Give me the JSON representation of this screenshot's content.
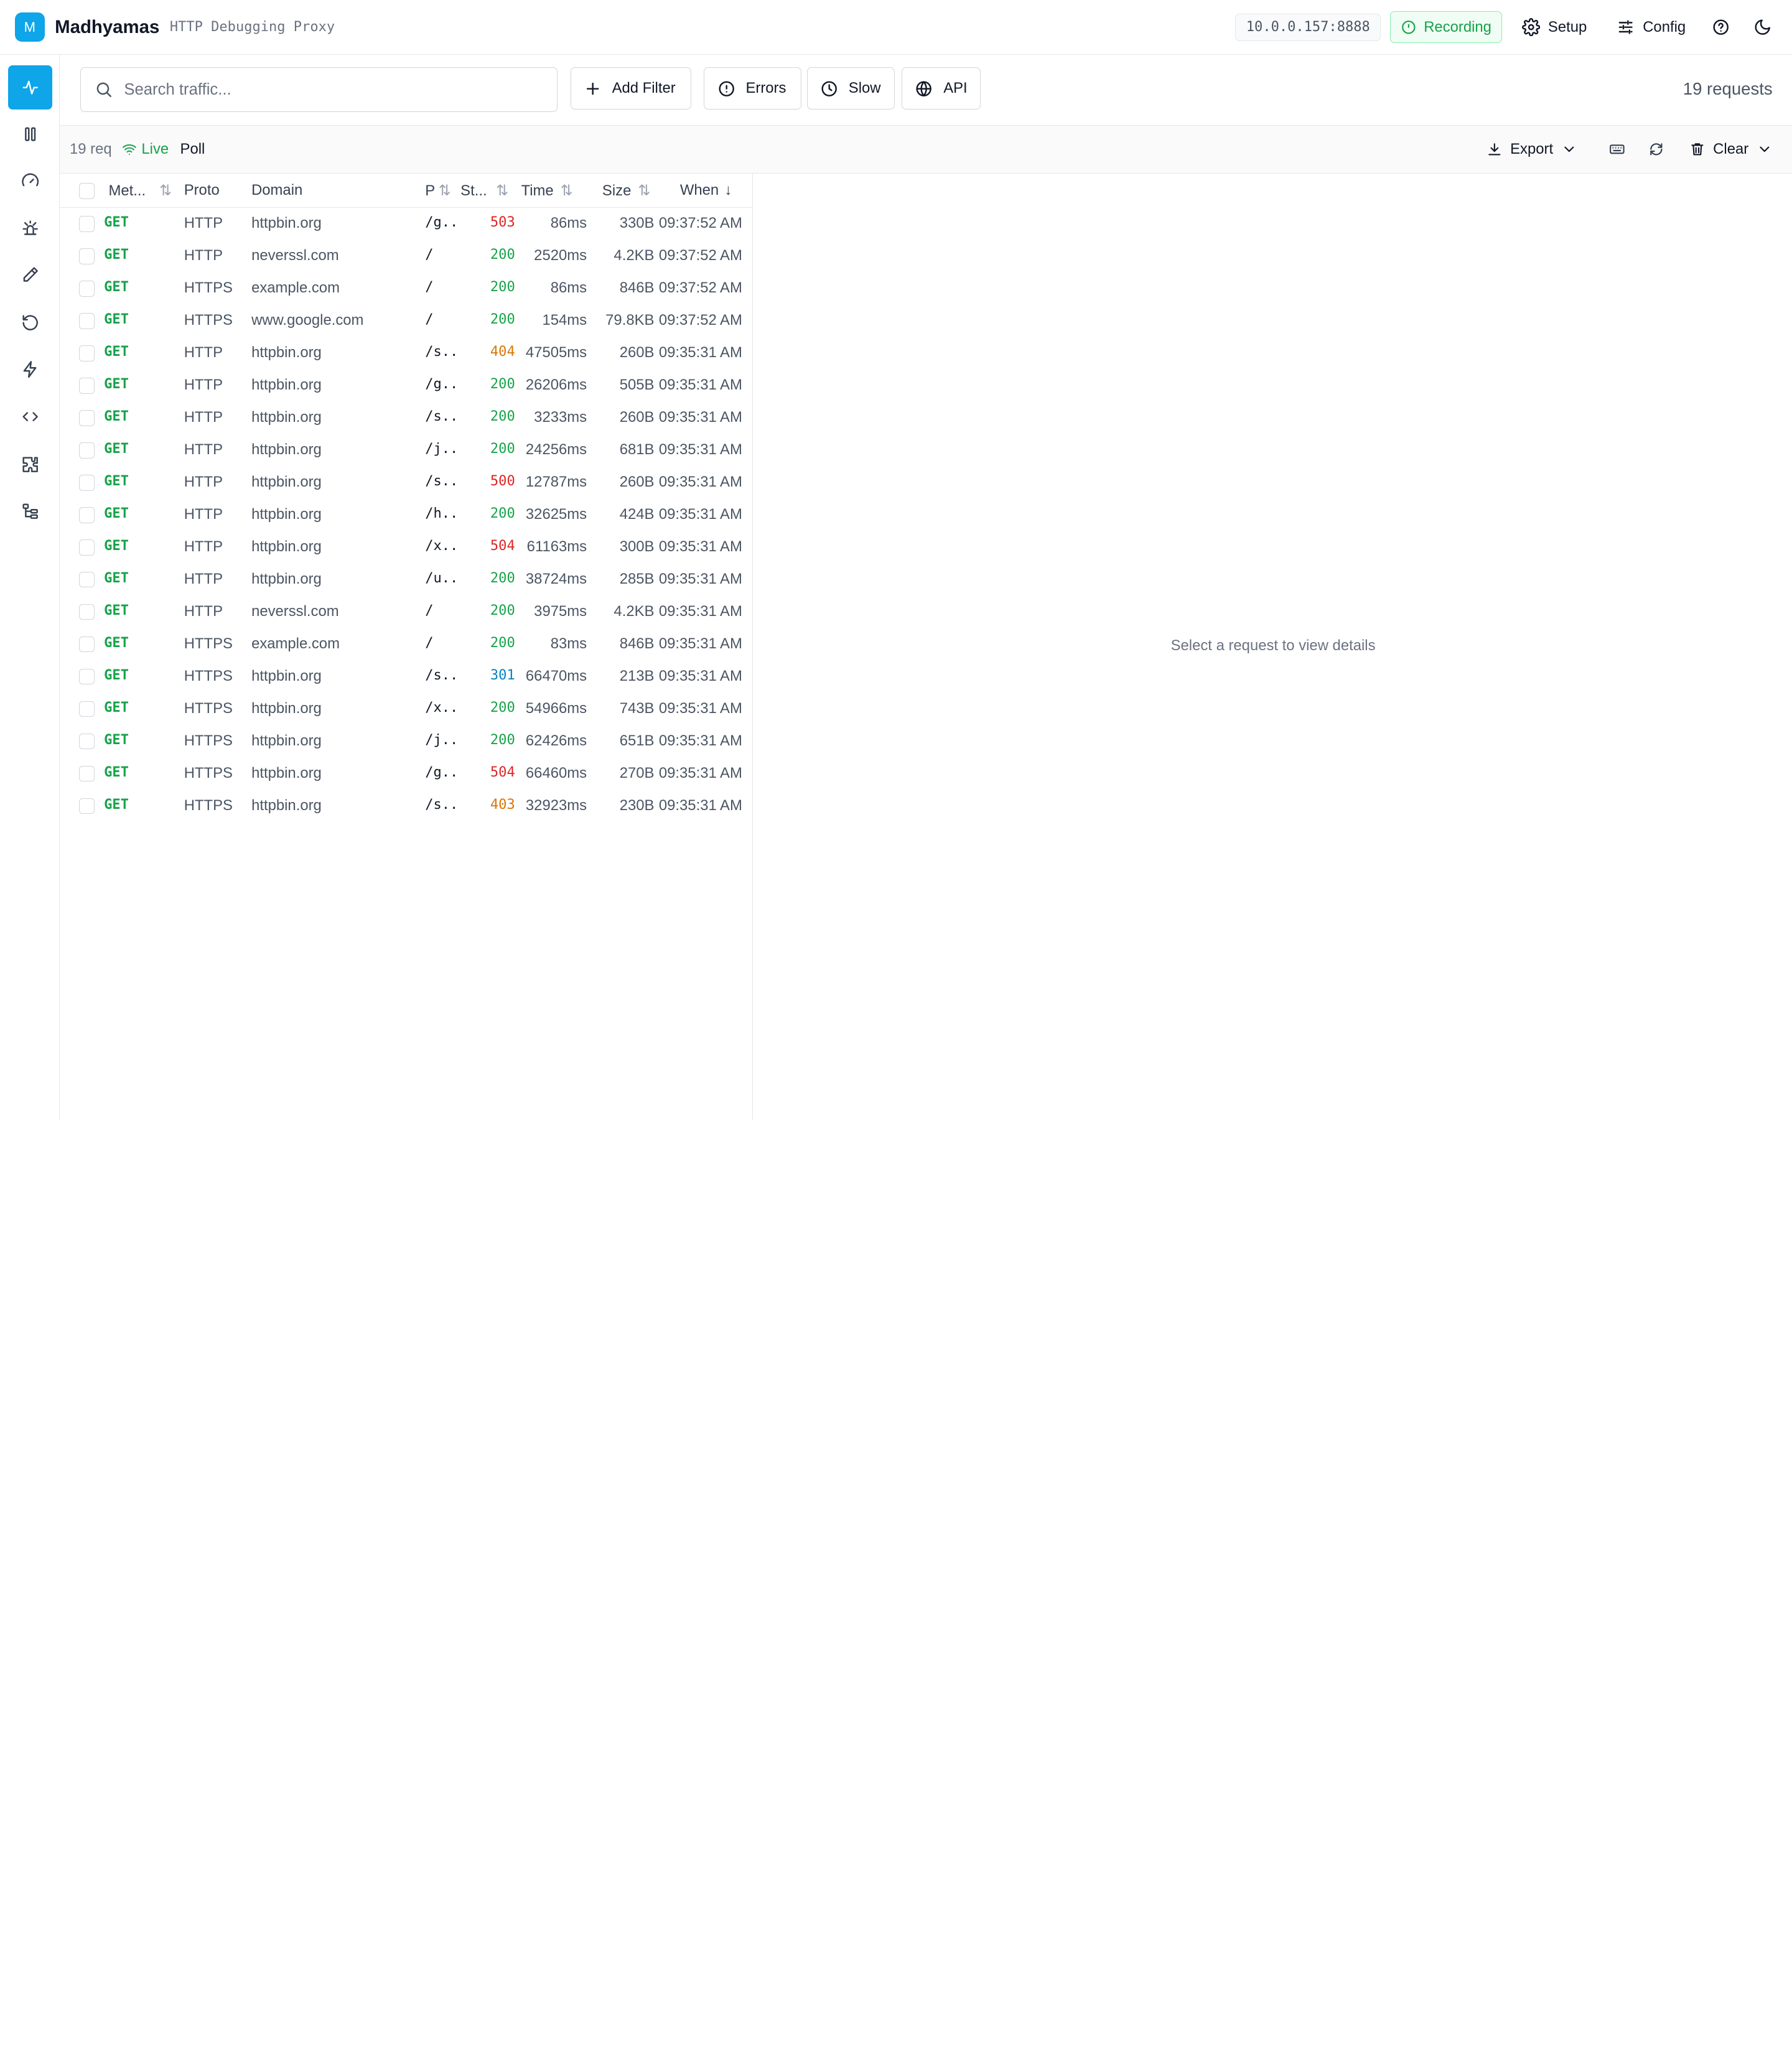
{
  "header": {
    "logo_letter": "M",
    "app_name": "Madhyamas",
    "subtitle": "HTTP Debugging Proxy",
    "address": "10.0.0.157:8888",
    "recording_label": "Recording",
    "setup_label": "Setup",
    "config_label": "Config"
  },
  "sidebar": {
    "items": [
      {
        "name": "activity",
        "icon": "activity-icon",
        "active": true
      },
      {
        "name": "columns",
        "icon": "columns-icon"
      },
      {
        "name": "dashboard",
        "icon": "gauge-icon"
      },
      {
        "name": "breakpoints",
        "icon": "bug-icon"
      },
      {
        "name": "compose",
        "icon": "pencil-icon"
      },
      {
        "name": "replay",
        "icon": "undo-icon"
      },
      {
        "name": "rules",
        "icon": "bolt-icon"
      },
      {
        "name": "scripts",
        "icon": "code-icon"
      },
      {
        "name": "plugins",
        "icon": "puzzle-icon"
      },
      {
        "name": "tree",
        "icon": "tree-icon"
      }
    ]
  },
  "toolbar": {
    "search_placeholder": "Search traffic...",
    "add_filter_label": "Add Filter",
    "errors_label": "Errors",
    "slow_label": "Slow",
    "api_label": "API",
    "request_count": "19 requests"
  },
  "subbar": {
    "req_count": "19 req",
    "live_label": "Live",
    "poll_label": "Poll",
    "export_label": "Export",
    "clear_label": "Clear"
  },
  "table": {
    "columns": {
      "method": "Met...",
      "proto": "Proto",
      "domain": "Domain",
      "path": "P",
      "status": "St...",
      "time": "Time",
      "size": "Size",
      "when": "When"
    },
    "rows": [
      {
        "method": "GET",
        "proto": "HTTP",
        "domain": "httpbin.org",
        "path": "/g...",
        "status": "503",
        "time": "86ms",
        "size": "330B",
        "when": "09:37:52 AM"
      },
      {
        "method": "GET",
        "proto": "HTTP",
        "domain": "neverssl.com",
        "path": "/",
        "status": "200",
        "time": "2520ms",
        "size": "4.2KB",
        "when": "09:37:52 AM"
      },
      {
        "method": "GET",
        "proto": "HTTPS",
        "domain": "example.com",
        "path": "/",
        "status": "200",
        "time": "86ms",
        "size": "846B",
        "when": "09:37:52 AM"
      },
      {
        "method": "GET",
        "proto": "HTTPS",
        "domain": "www.google.com",
        "path": "/",
        "status": "200",
        "time": "154ms",
        "size": "79.8KB",
        "when": "09:37:52 AM"
      },
      {
        "method": "GET",
        "proto": "HTTP",
        "domain": "httpbin.org",
        "path": "/s...",
        "status": "404",
        "time": "47505ms",
        "size": "260B",
        "when": "09:35:31 AM"
      },
      {
        "method": "GET",
        "proto": "HTTP",
        "domain": "httpbin.org",
        "path": "/g...",
        "status": "200",
        "time": "26206ms",
        "size": "505B",
        "when": "09:35:31 AM"
      },
      {
        "method": "GET",
        "proto": "HTTP",
        "domain": "httpbin.org",
        "path": "/s...",
        "status": "200",
        "time": "3233ms",
        "size": "260B",
        "when": "09:35:31 AM"
      },
      {
        "method": "GET",
        "proto": "HTTP",
        "domain": "httpbin.org",
        "path": "/j...",
        "status": "200",
        "time": "24256ms",
        "size": "681B",
        "when": "09:35:31 AM"
      },
      {
        "method": "GET",
        "proto": "HTTP",
        "domain": "httpbin.org",
        "path": "/s...",
        "status": "500",
        "time": "12787ms",
        "size": "260B",
        "when": "09:35:31 AM"
      },
      {
        "method": "GET",
        "proto": "HTTP",
        "domain": "httpbin.org",
        "path": "/h...",
        "status": "200",
        "time": "32625ms",
        "size": "424B",
        "when": "09:35:31 AM"
      },
      {
        "method": "GET",
        "proto": "HTTP",
        "domain": "httpbin.org",
        "path": "/x...",
        "status": "504",
        "time": "61163ms",
        "size": "300B",
        "when": "09:35:31 AM"
      },
      {
        "method": "GET",
        "proto": "HTTP",
        "domain": "httpbin.org",
        "path": "/u...",
        "status": "200",
        "time": "38724ms",
        "size": "285B",
        "when": "09:35:31 AM"
      },
      {
        "method": "GET",
        "proto": "HTTP",
        "domain": "neverssl.com",
        "path": "/",
        "status": "200",
        "time": "3975ms",
        "size": "4.2KB",
        "when": "09:35:31 AM"
      },
      {
        "method": "GET",
        "proto": "HTTPS",
        "domain": "example.com",
        "path": "/",
        "status": "200",
        "time": "83ms",
        "size": "846B",
        "when": "09:35:31 AM"
      },
      {
        "method": "GET",
        "proto": "HTTPS",
        "domain": "httpbin.org",
        "path": "/s...",
        "status": "301",
        "time": "66470ms",
        "size": "213B",
        "when": "09:35:31 AM"
      },
      {
        "method": "GET",
        "proto": "HTTPS",
        "domain": "httpbin.org",
        "path": "/x...",
        "status": "200",
        "time": "54966ms",
        "size": "743B",
        "when": "09:35:31 AM"
      },
      {
        "method": "GET",
        "proto": "HTTPS",
        "domain": "httpbin.org",
        "path": "/j...",
        "status": "200",
        "time": "62426ms",
        "size": "651B",
        "when": "09:35:31 AM"
      },
      {
        "method": "GET",
        "proto": "HTTPS",
        "domain": "httpbin.org",
        "path": "/g...",
        "status": "504",
        "time": "66460ms",
        "size": "270B",
        "when": "09:35:31 AM"
      },
      {
        "method": "GET",
        "proto": "HTTPS",
        "domain": "httpbin.org",
        "path": "/s...",
        "status": "403",
        "time": "32923ms",
        "size": "230B",
        "when": "09:35:31 AM"
      }
    ]
  },
  "status_colors": {
    "2xx": "#16a34a",
    "3xx": "#0284c7",
    "4xx": "#d97706",
    "5xx": "#dc2626"
  },
  "detail": {
    "empty_message": "Select a request to view details"
  },
  "colors": {
    "accent": "#0ea5e9",
    "recording": "#16a34a"
  }
}
